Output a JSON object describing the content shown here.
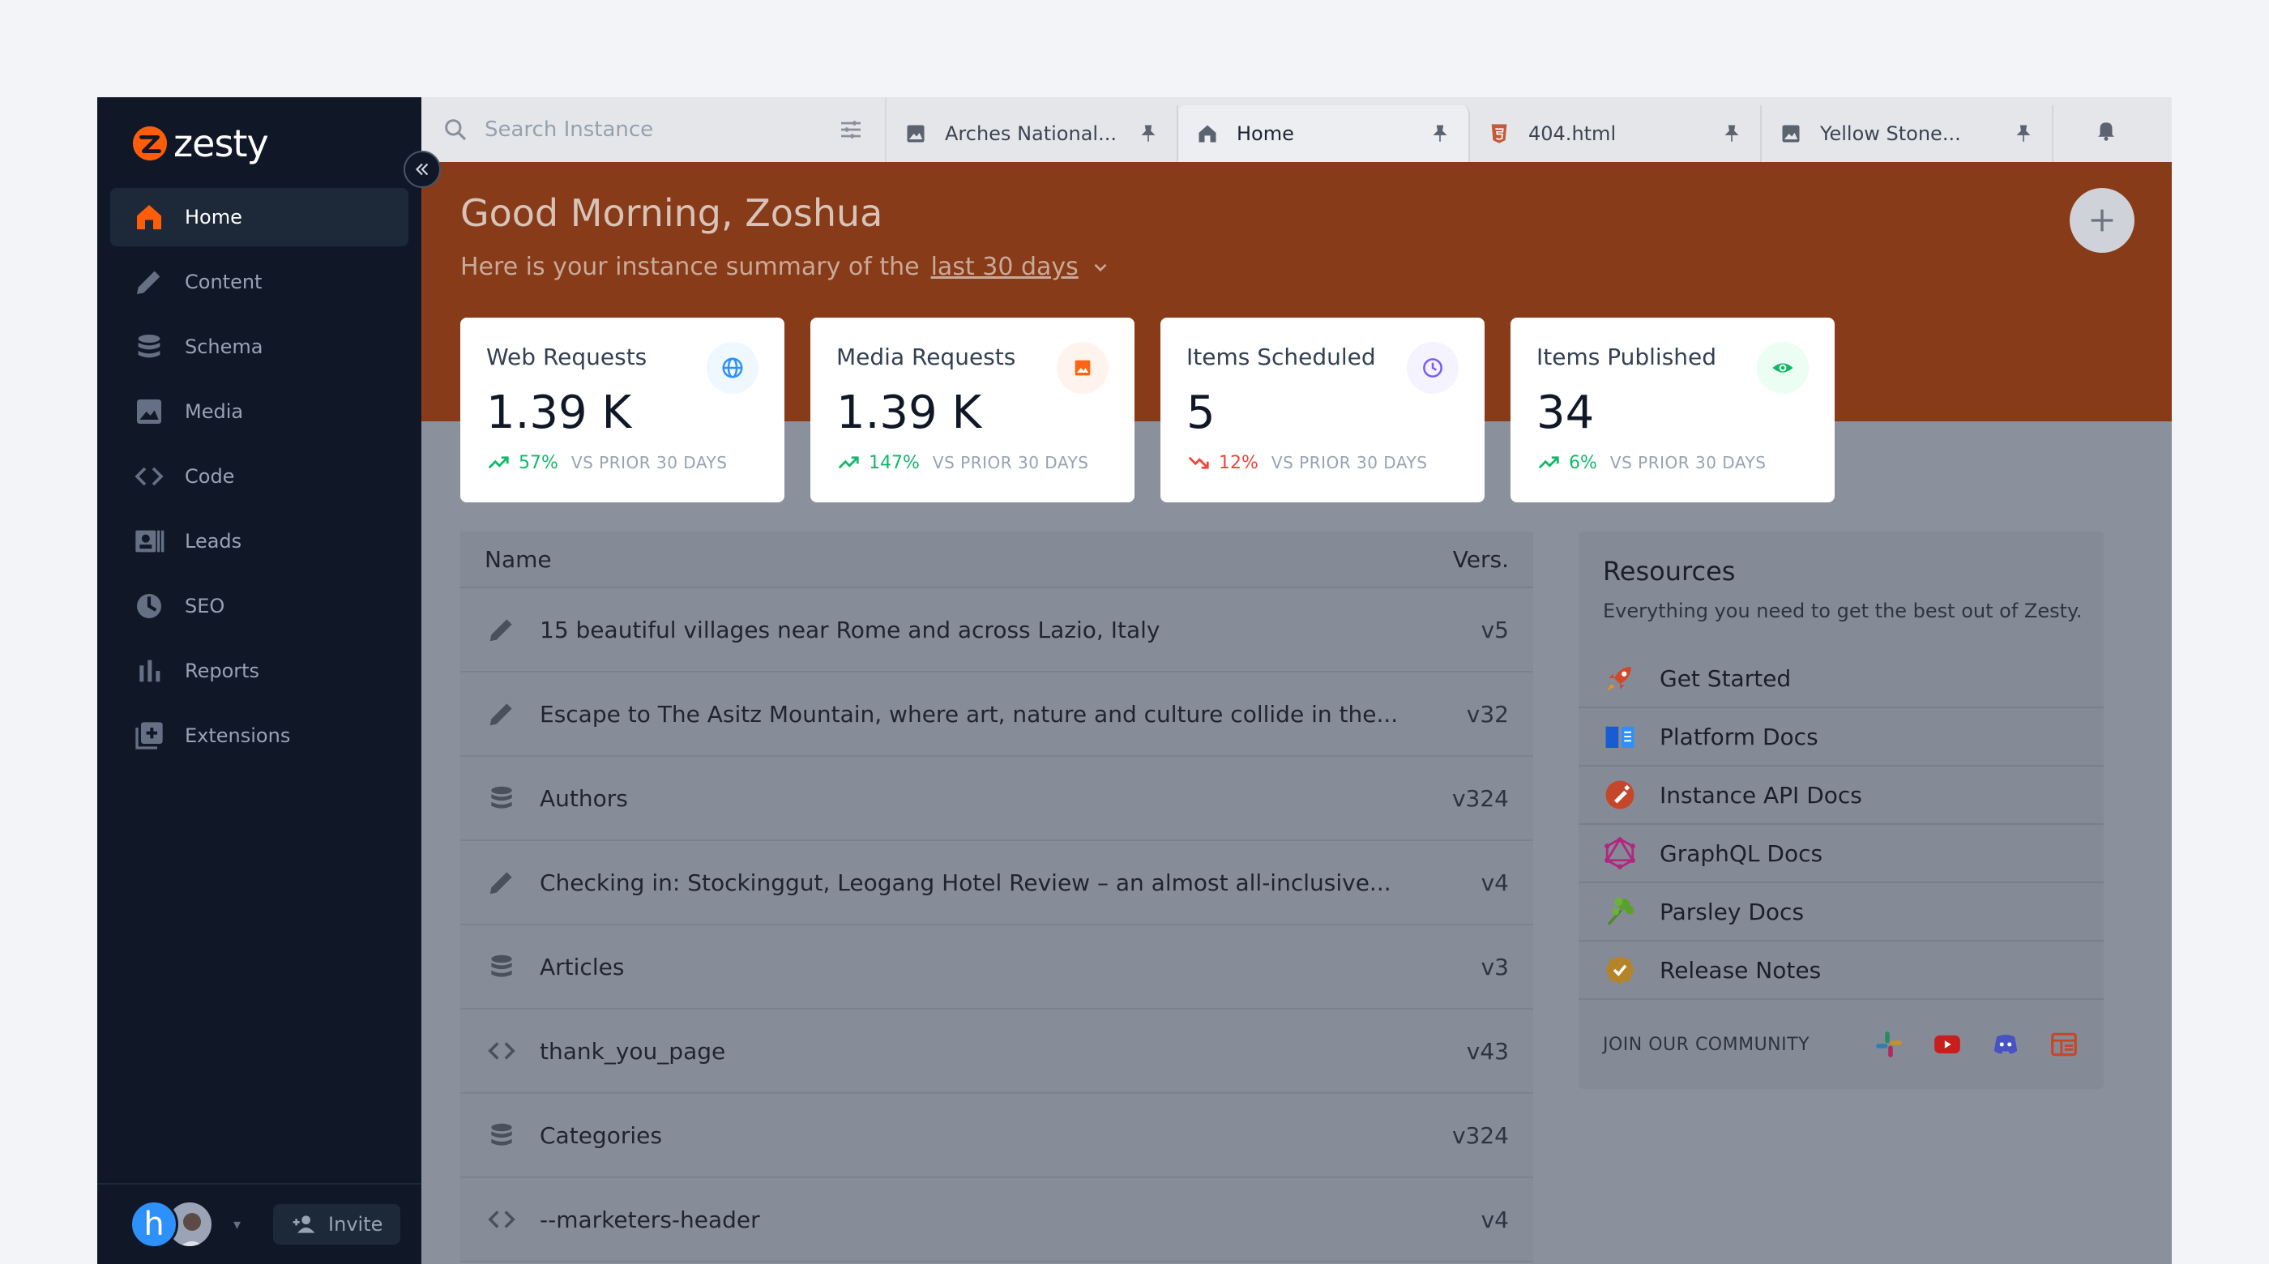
{
  "app": {
    "logo_text": "zesty"
  },
  "sidebar": {
    "items": [
      {
        "label": "Home",
        "icon": "home-icon"
      },
      {
        "label": "Content",
        "icon": "pencil-icon"
      },
      {
        "label": "Schema",
        "icon": "database-icon"
      },
      {
        "label": "Media",
        "icon": "image-icon"
      },
      {
        "label": "Code",
        "icon": "code-icon"
      },
      {
        "label": "Leads",
        "icon": "contact-icon"
      },
      {
        "label": "SEO",
        "icon": "seo-icon"
      },
      {
        "label": "Reports",
        "icon": "bar-chart-icon"
      },
      {
        "label": "Extensions",
        "icon": "extensions-icon"
      }
    ],
    "avatar_initial": "h",
    "invite_label": "Invite"
  },
  "topbar": {
    "search_placeholder": "Search Instance",
    "tabs": [
      {
        "label": "Arches National...",
        "icon": "image-icon"
      },
      {
        "label": "Home",
        "icon": "home-icon"
      },
      {
        "label": "404.html",
        "icon": "html5-icon"
      },
      {
        "label": "Yellow Stone...",
        "icon": "image-icon"
      }
    ]
  },
  "hero": {
    "greeting": "Good Morning, Zoshua",
    "summary_prefix": "Here is your instance summary of the",
    "summary_range": "last 30 days"
  },
  "cards": [
    {
      "label": "Web Requests",
      "value": "1.39 K",
      "pct": "57%",
      "trend": "up",
      "vs": "VS PRIOR 30 DAYS",
      "icon": "globe-icon"
    },
    {
      "label": "Media Requests",
      "value": "1.39 K",
      "pct": "147%",
      "trend": "up",
      "vs": "VS PRIOR 30 DAYS",
      "icon": "image-icon"
    },
    {
      "label": "Items Scheduled",
      "value": "5",
      "pct": "12%",
      "trend": "down",
      "vs": "VS PRIOR 30 DAYS",
      "icon": "clock-icon"
    },
    {
      "label": "Items Published",
      "value": "34",
      "pct": "6%",
      "trend": "up",
      "vs": "VS PRIOR 30 DAYS",
      "icon": "eye-icon"
    }
  ],
  "table": {
    "col_name": "Name",
    "col_ver": "Vers.",
    "rows": [
      {
        "name": "15 beautiful villages near Rome and across Lazio, Italy",
        "ver": "v5",
        "icon": "pencil-icon"
      },
      {
        "name": "Escape to The Asitz Mountain, where art, nature and culture collide in the...",
        "ver": "v32",
        "icon": "pencil-icon"
      },
      {
        "name": "Authors",
        "ver": "v324",
        "icon": "database-icon"
      },
      {
        "name": "Checking in: Stockinggut, Leogang Hotel Review – an almost all-inclusive...",
        "ver": "v4",
        "icon": "pencil-icon"
      },
      {
        "name": "Articles",
        "ver": "v3",
        "icon": "database-icon"
      },
      {
        "name": "thank_you_page",
        "ver": "v43",
        "icon": "code-icon"
      },
      {
        "name": "Categories",
        "ver": "v324",
        "icon": "database-icon"
      },
      {
        "name": "--marketers-header",
        "ver": "v4",
        "icon": "code-icon"
      }
    ]
  },
  "resources": {
    "title": "Resources",
    "subtitle": "Everything you need to get the best out of Zesty.",
    "items": [
      {
        "label": "Get Started",
        "icon": "rocket-icon"
      },
      {
        "label": "Platform Docs",
        "icon": "book-icon"
      },
      {
        "label": "Instance API Docs",
        "icon": "api-icon"
      },
      {
        "label": "GraphQL Docs",
        "icon": "graphql-icon"
      },
      {
        "label": "Parsley Docs",
        "icon": "parsley-icon"
      },
      {
        "label": "Release Notes",
        "icon": "badge-check-icon"
      }
    ],
    "community_label": "JOIN OUR COMMUNITY",
    "community_icons": [
      "slack-icon",
      "youtube-icon",
      "discord-icon",
      "blog-icon"
    ]
  },
  "colors": {
    "sidebar_bg": "#101828",
    "hero_bg": "#873b18",
    "brand_orange": "#ff5d0a",
    "trend_up": "#12b76a",
    "trend_down": "#f04438"
  }
}
